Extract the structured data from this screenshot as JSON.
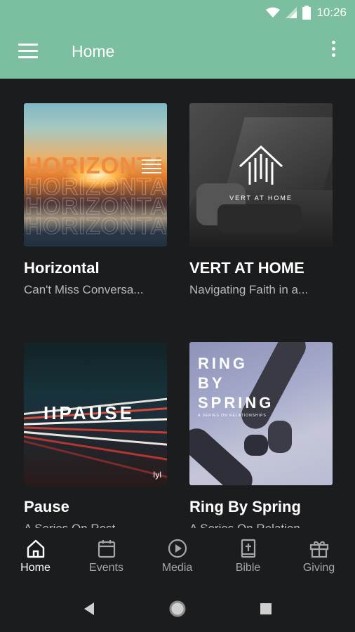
{
  "status_bar": {
    "time": "10:26"
  },
  "app_bar": {
    "title": "Home"
  },
  "cards": [
    {
      "title": "Horizontal",
      "subtitle": "Can't Miss Conversa...",
      "art_text": "HORIZONTAL"
    },
    {
      "title": "VERT AT HOME",
      "subtitle": "Navigating Faith in a...",
      "art_text": "VERT AT HOME"
    },
    {
      "title": "Pause",
      "subtitle": "A Series On Rest",
      "art_text": "IIPAUSE"
    },
    {
      "title": "Ring By Spring",
      "subtitle": "A Series On Relation",
      "art_text": [
        "RING",
        "BY",
        "SPRING"
      ],
      "art_small": "A SERIES ON RELATIONSHIPS"
    }
  ],
  "bottom_nav": [
    {
      "label": "Home",
      "icon": "home-icon",
      "active": true
    },
    {
      "label": "Events",
      "icon": "calendar-icon",
      "active": false
    },
    {
      "label": "Media",
      "icon": "play-circle-icon",
      "active": false
    },
    {
      "label": "Bible",
      "icon": "bible-icon",
      "active": false
    },
    {
      "label": "Giving",
      "icon": "gift-icon",
      "active": false
    }
  ],
  "colors": {
    "app_bar": "#7bbfa0",
    "background": "#1b1c1e",
    "subtitle": "#b9b9b9",
    "nav_inactive": "#a7a7a7"
  }
}
